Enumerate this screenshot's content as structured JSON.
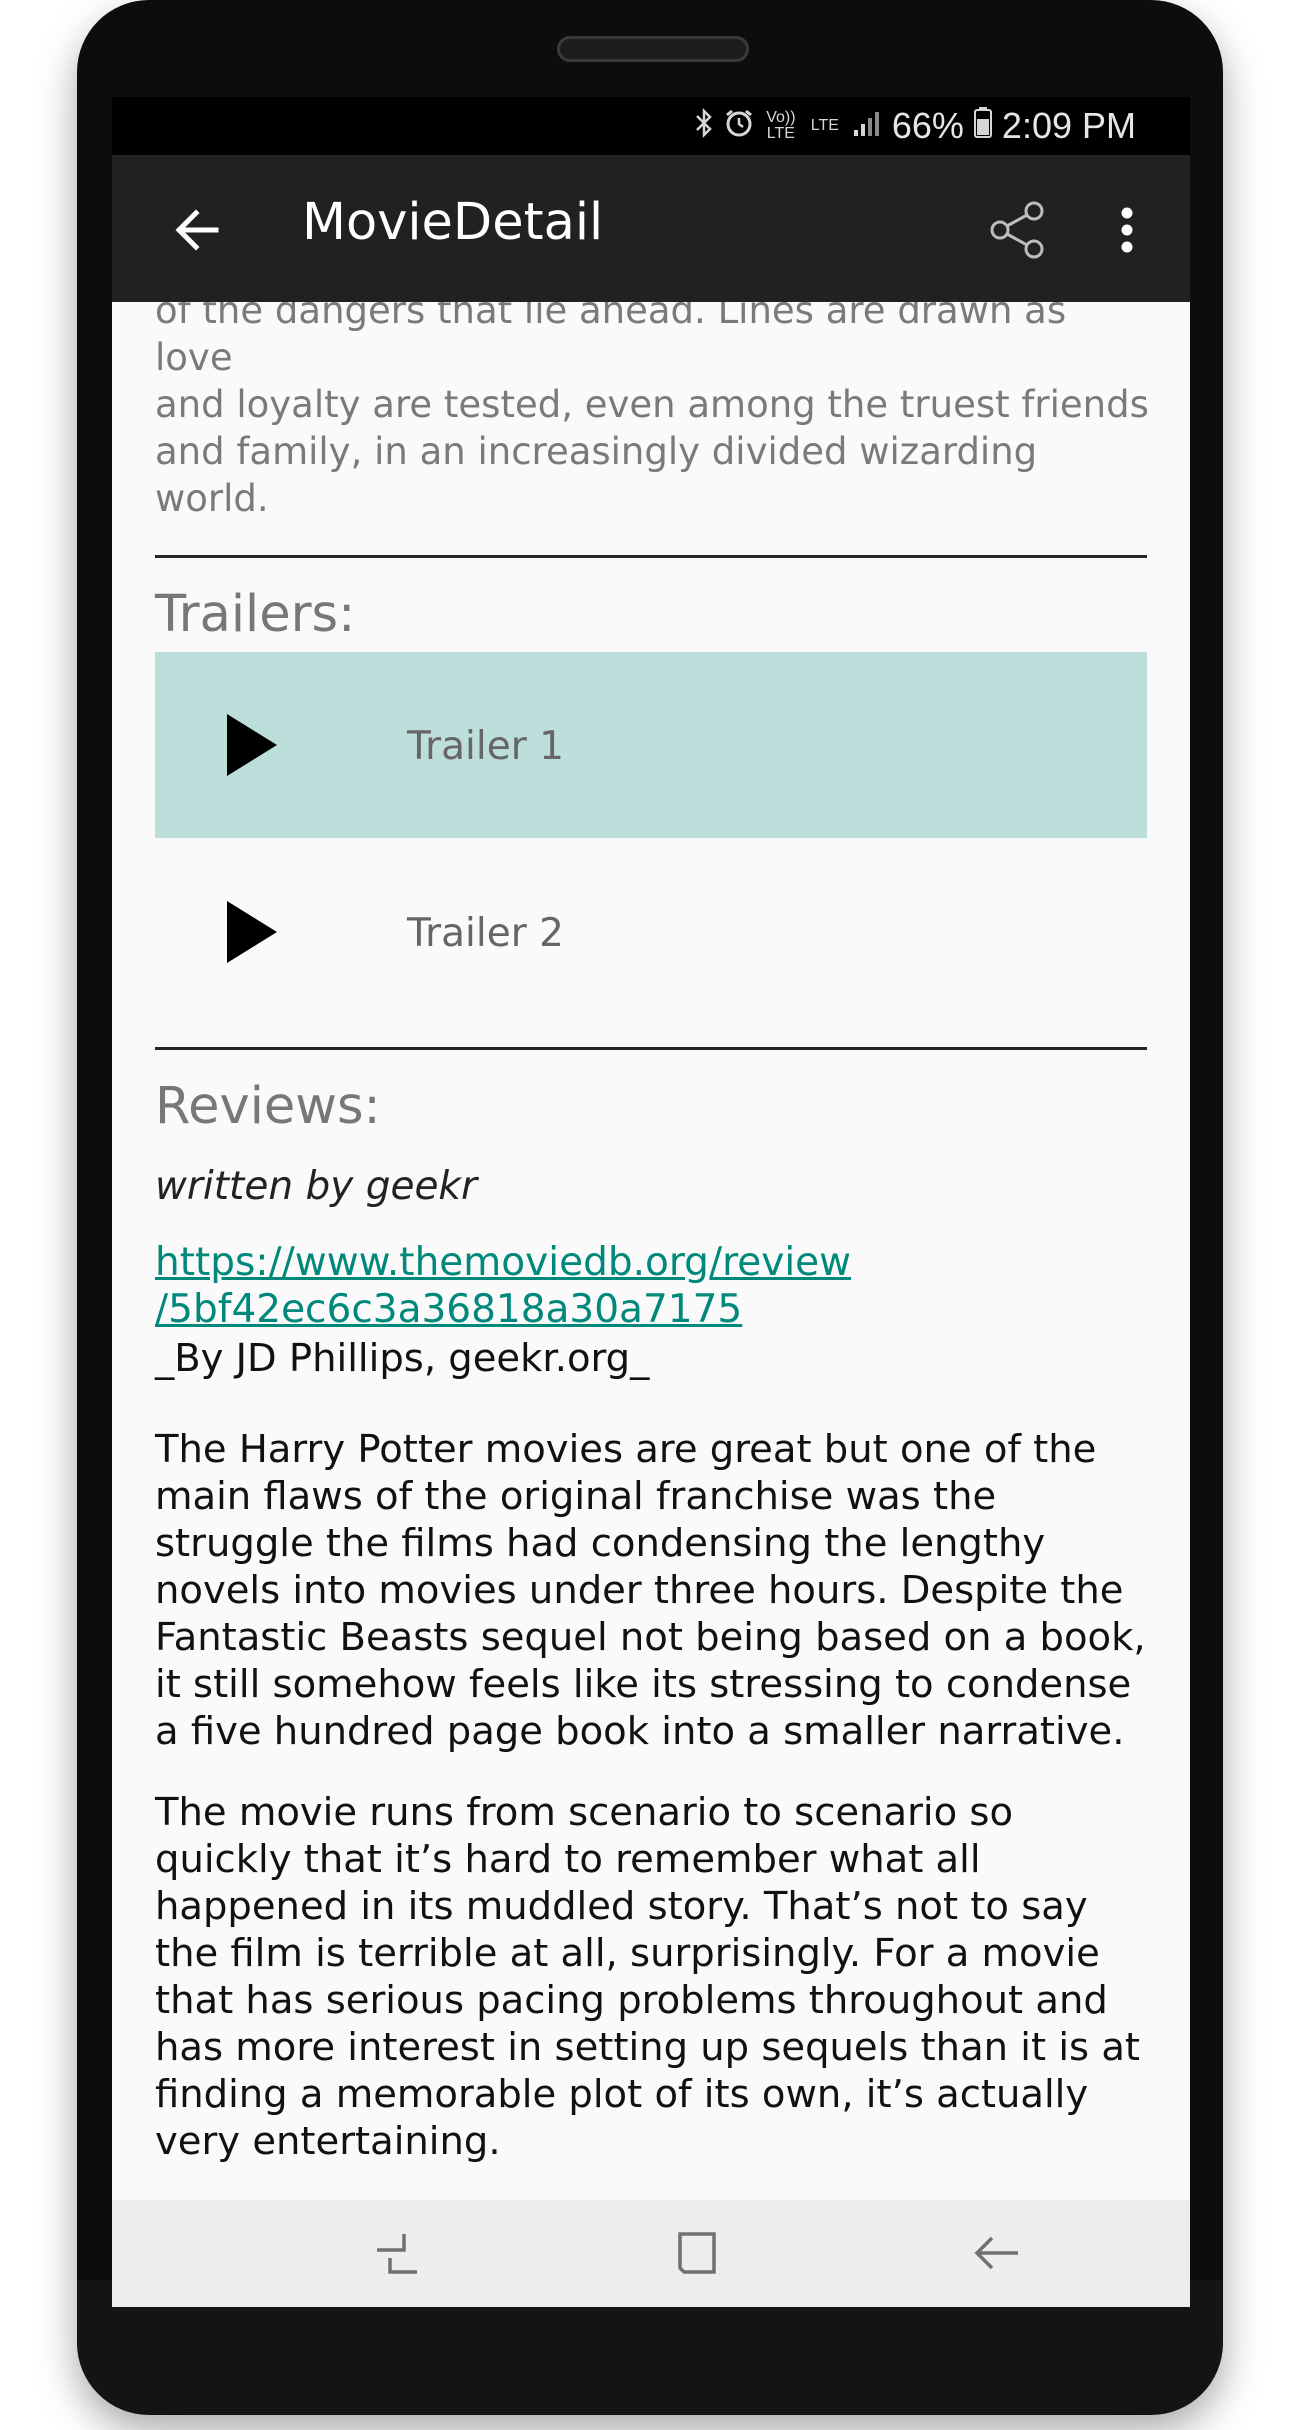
{
  "status_bar": {
    "network_icons": [
      "bluetooth-icon",
      "alarm-icon"
    ],
    "volte": "Vo)) LTE",
    "lte": "LTE",
    "battery": "66%",
    "time": "2:09 PM"
  },
  "toolbar": {
    "title": "MovieDetail",
    "back_icon": "arrow-left-icon",
    "share_icon": "share-icon",
    "more_icon": "more-vert-icon"
  },
  "overview": {
    "lines": [
      "of the dangers that lie ahead. Lines are drawn as love",
      "and loyalty are tested, even among the truest friends",
      "and family, in an increasingly divided wizarding world."
    ]
  },
  "trailers": {
    "title": "Trailers:",
    "items": [
      {
        "label": "Trailer 1",
        "icon": "play-icon"
      },
      {
        "label": "Trailer 2",
        "icon": "play-icon"
      }
    ]
  },
  "reviews": {
    "title": "Reviews:",
    "author": "written by geekr",
    "url_line1": "https://www.themoviedb.org/review",
    "url_line2": "/5bf42ec6c3a36818a30a7175",
    "byline": "_By JD Phillips, geekr.org_",
    "paragraph1": "The Harry Potter movies are great but one of the main flaws of the original franchise was the struggle the films had condensing the lengthy novels into movies under three hours. Despite the Fantastic Beasts sequel not being based on a book, it still somehow feels like its stressing to condense a five hundred page book into a smaller narrative.",
    "paragraph2": "The movie runs from scenario to scenario so quickly that it’s hard to remember what all happened in its muddled story. That’s not to say the film is terrible at all, surprisingly. For a movie that has serious pacing problems throughout and has more interest in setting up sequels than it is at finding a memorable plot of its own, it’s actually very entertaining."
  },
  "navbar": {
    "recents_icon": "recent-apps-icon",
    "home_icon": "home-icon",
    "back_icon": "nav-back-icon"
  },
  "colors": {
    "toolbar_bg": "#212121",
    "accent_link": "#00897b",
    "selected_row_bg": "#bcdfdc"
  }
}
